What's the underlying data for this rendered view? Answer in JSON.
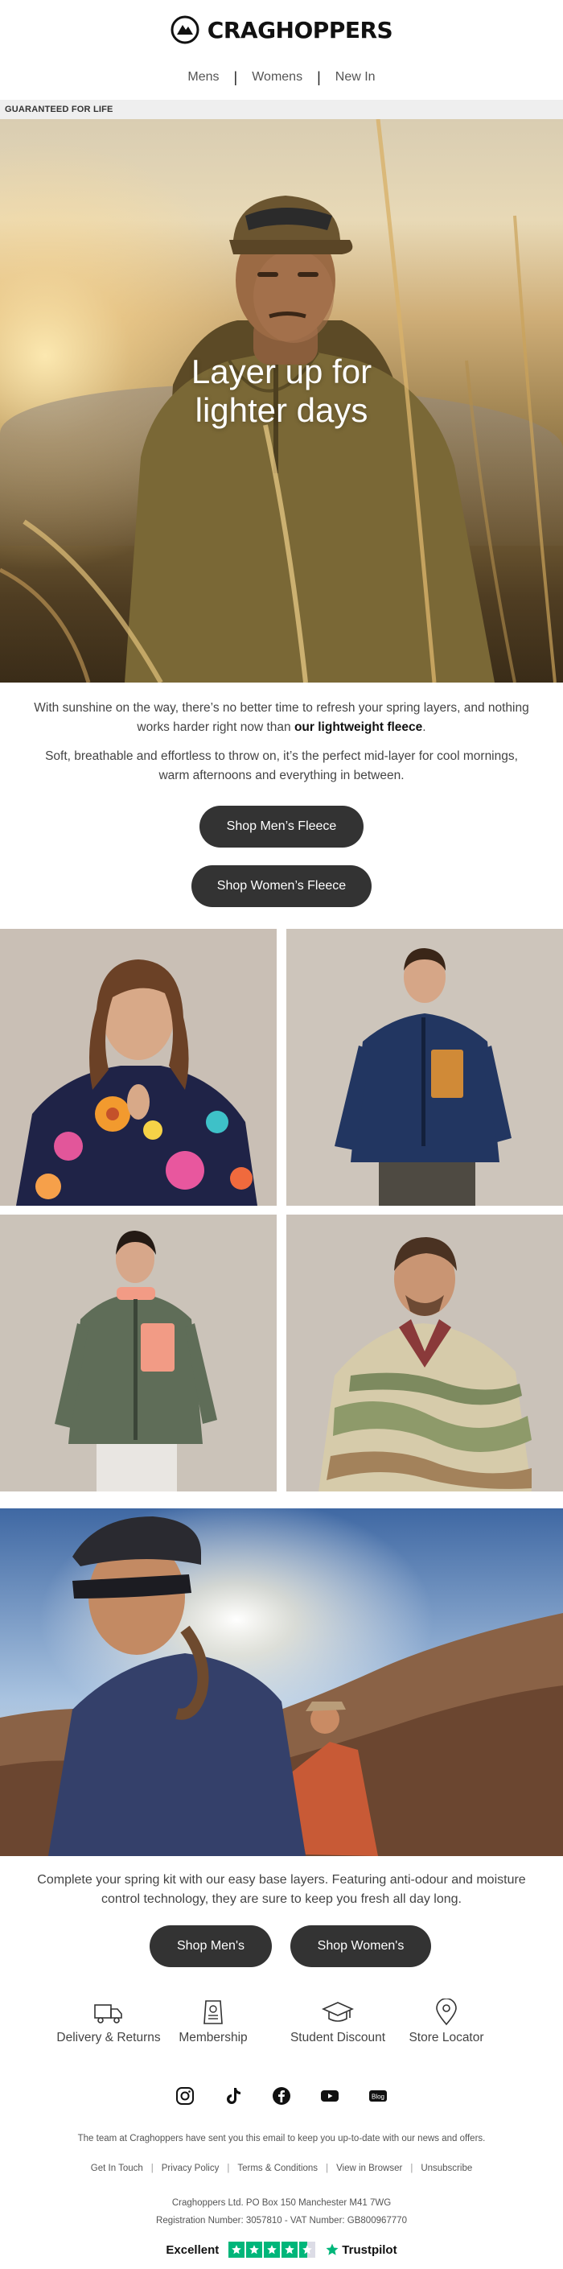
{
  "brand": {
    "name": "CRAGHOPPERS"
  },
  "nav": {
    "items": [
      "Mens",
      "Womens",
      "New In"
    ],
    "separator": "|"
  },
  "guarantee": {
    "text": "GUARANTEED FOR LIFE"
  },
  "hero": {
    "title_line1": "Layer up for",
    "title_line2": "lighter days"
  },
  "intro": {
    "p1_text": "With sunshine on the way, there’s no better time to refresh your spring layers, and nothing works harder right now than ",
    "p1_bold": "our lightweight fleece",
    "p1_end": ".",
    "p2": "Soft, breathable and effortless to throw on, it’s the perfect mid-layer for cool mornings, warm afternoons and everything in between."
  },
  "buttons": {
    "shop_mens_fleece": "Shop Men’s Fleece",
    "shop_womens_fleece": "Shop Women’s Fleece",
    "shop_mens": "Shop Men's",
    "shop_womens": "Shop Women's"
  },
  "copy2": "Complete your spring kit with our easy base layers. Featuring anti-odour and moisture control technology, they are sure to keep you fresh all day long.",
  "features": [
    {
      "label": "Delivery & Returns",
      "icon": "delivery-truck-icon"
    },
    {
      "label": "Membership",
      "icon": "membership-card-icon"
    },
    {
      "label": "Student Discount",
      "icon": "graduation-cap-icon"
    },
    {
      "label": "Store Locator",
      "icon": "map-pin-icon"
    }
  ],
  "social": [
    "instagram-icon",
    "tiktok-icon",
    "facebook-icon",
    "youtube-icon",
    "blog-icon"
  ],
  "social_blog_label": "Blog",
  "footer": {
    "notice": "The team at Craghoppers have sent you this email to keep you up-to-date with our news and offers.",
    "links": [
      "Get In Touch",
      "Privacy Policy",
      "Terms & Conditions",
      "View in Browser",
      "Unsubscribe"
    ],
    "address": "Craghoppers Ltd. PO Box 150 Manchester M41 7WG",
    "registration": "Registration Number: 3057810 - VAT Number: GB800967770"
  },
  "trustpilot": {
    "rating_label": "Excellent",
    "brand": "Trustpilot",
    "stars": 4.5
  },
  "colors": {
    "button": "#333333",
    "trustpilot_green": "#00b67a",
    "guarantee_bar": "#efefef"
  }
}
